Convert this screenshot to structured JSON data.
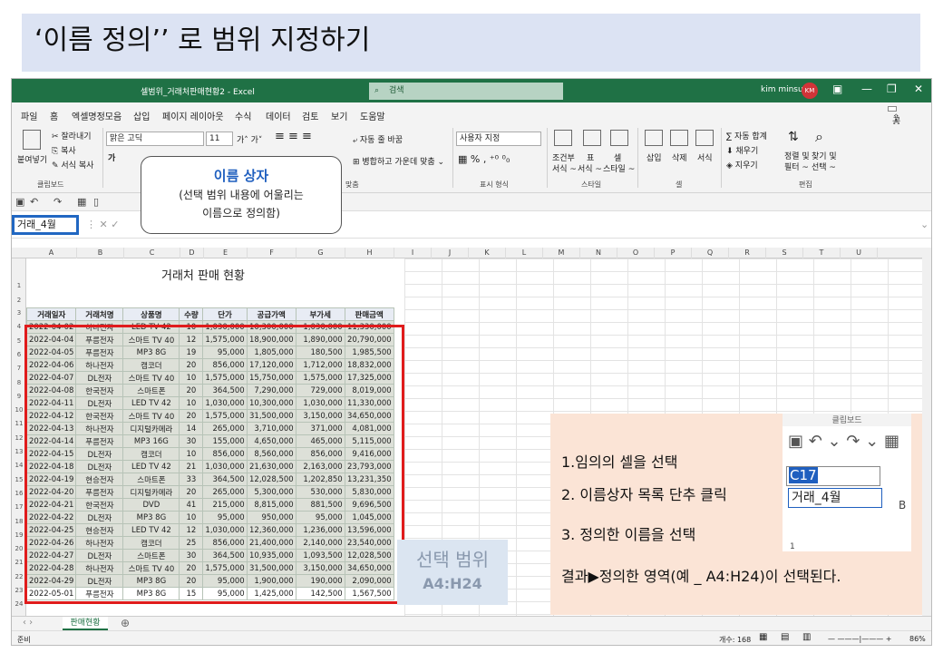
{
  "slide_title": "‘이름 정의’’ 로 범위 지정하기",
  "titlebar": {
    "doc_title": "셀범위_거래처판매현황2 - Excel",
    "search_placeholder": "검색",
    "user": "kim minsu",
    "avatar": "KM"
  },
  "tabs": [
    "파일",
    "홈",
    "엑셀명정모음",
    "삽입",
    "페이지 레이아웃",
    "수식",
    "데이터",
    "검토",
    "보기",
    "도움말"
  ],
  "share": "공유",
  "ribbon": {
    "cut": "잘라내기",
    "copy": "복사",
    "paste": "붙여넣기",
    "format_painter": "서식 복사",
    "font": "맑은 고딕",
    "font_size": "11",
    "wrap": "자동 줄 바꿈",
    "merge": "병합하고 가운데 맞춤",
    "number_format": "사용자 지정",
    "conditional": "조건부",
    "table": "표",
    "cell": "셀",
    "format_sub1": "서식 ~",
    "format_sub2": "서식 ~",
    "style_sub": "스타일 ~",
    "insert": "삽입",
    "delete": "삭제",
    "format": "서식",
    "autosum": "자동 합계",
    "fill": "채우기",
    "clear": "지우기",
    "sort": "정렬 및",
    "sort2": "필터 ~",
    "find": "찾기 및",
    "find2": "선택 ~",
    "group_clipboard": "클립보드",
    "group_align": "맞춤",
    "group_number": "표시 형식",
    "group_style": "스타일",
    "group_cells": "셀",
    "group_edit": "편집"
  },
  "namebox": "거래_4월",
  "callout": {
    "heading": "이름 상자",
    "line1": "(선택 범위 내용에 어울리는",
    "line2": "이름으로 정의함)"
  },
  "columns": [
    "A",
    "B",
    "C",
    "D",
    "E",
    "F",
    "G",
    "H",
    "I",
    "J",
    "K",
    "L",
    "M",
    "N",
    "O",
    "P",
    "Q",
    "R",
    "S",
    "T",
    "U"
  ],
  "sheet_title": "거래처 판매 현황",
  "table": {
    "headers": [
      "거래일자",
      "거래처명",
      "상품명",
      "수량",
      "단가",
      "공급가액",
      "부가세",
      "판매금액"
    ],
    "rows": [
      [
        "2022-04-02",
        "하나전자",
        "LED TV 42",
        "10",
        "1,030,000",
        "10,300,000",
        "1,030,000",
        "11,330,000"
      ],
      [
        "2022-04-04",
        "푸름전자",
        "스마트 TV 40",
        "12",
        "1,575,000",
        "18,900,000",
        "1,890,000",
        "20,790,000"
      ],
      [
        "2022-04-05",
        "푸름전자",
        "MP3 8G",
        "19",
        "95,000",
        "1,805,000",
        "180,500",
        "1,985,500"
      ],
      [
        "2022-04-06",
        "하나전자",
        "캠코더",
        "20",
        "856,000",
        "17,120,000",
        "1,712,000",
        "18,832,000"
      ],
      [
        "2022-04-07",
        "DL전자",
        "스마트 TV 40",
        "10",
        "1,575,000",
        "15,750,000",
        "1,575,000",
        "17,325,000"
      ],
      [
        "2022-04-08",
        "한국전자",
        "스마트폰",
        "20",
        "364,500",
        "7,290,000",
        "729,000",
        "8,019,000"
      ],
      [
        "2022-04-11",
        "DL전자",
        "LED TV 42",
        "10",
        "1,030,000",
        "10,300,000",
        "1,030,000",
        "11,330,000"
      ],
      [
        "2022-04-12",
        "한국전자",
        "스마트 TV 40",
        "20",
        "1,575,000",
        "31,500,000",
        "3,150,000",
        "34,650,000"
      ],
      [
        "2022-04-13",
        "하나전자",
        "디지털카메라",
        "14",
        "265,000",
        "3,710,000",
        "371,000",
        "4,081,000"
      ],
      [
        "2022-04-14",
        "푸름전자",
        "MP3 16G",
        "30",
        "155,000",
        "4,650,000",
        "465,000",
        "5,115,000"
      ],
      [
        "2022-04-15",
        "DL전자",
        "캠코더",
        "10",
        "856,000",
        "8,560,000",
        "856,000",
        "9,416,000"
      ],
      [
        "2022-04-18",
        "DL전자",
        "LED TV 42",
        "21",
        "1,030,000",
        "21,630,000",
        "2,163,000",
        "23,793,000"
      ],
      [
        "2022-04-19",
        "현승전자",
        "스마트폰",
        "33",
        "364,500",
        "12,028,500",
        "1,202,850",
        "13,231,350"
      ],
      [
        "2022-04-20",
        "푸름전자",
        "디지털카메라",
        "20",
        "265,000",
        "5,300,000",
        "530,000",
        "5,830,000"
      ],
      [
        "2022-04-21",
        "한국전자",
        "DVD",
        "41",
        "215,000",
        "8,815,000",
        "881,500",
        "9,696,500"
      ],
      [
        "2022-04-22",
        "DL전자",
        "MP3 8G",
        "10",
        "95,000",
        "950,000",
        "95,000",
        "1,045,000"
      ],
      [
        "2022-04-25",
        "현승전자",
        "LED TV 42",
        "12",
        "1,030,000",
        "12,360,000",
        "1,236,000",
        "13,596,000"
      ],
      [
        "2022-04-26",
        "하나전자",
        "캠코더",
        "25",
        "856,000",
        "21,400,000",
        "2,140,000",
        "23,540,000"
      ],
      [
        "2022-04-27",
        "DL전자",
        "스마트폰",
        "30",
        "364,500",
        "10,935,000",
        "1,093,500",
        "12,028,500"
      ],
      [
        "2022-04-28",
        "하나전자",
        "스마트 TV 40",
        "20",
        "1,575,000",
        "31,500,000",
        "3,150,000",
        "34,650,000"
      ],
      [
        "2022-04-29",
        "DL전자",
        "MP3 8G",
        "20",
        "95,000",
        "1,900,000",
        "190,000",
        "2,090,000"
      ],
      [
        "2022-05-01",
        "푸름전자",
        "MP3 8G",
        "15",
        "95,000",
        "1,425,000",
        "142,500",
        "1,567,500"
      ]
    ]
  },
  "sheet_tab": "판매현황",
  "status": {
    "ready": "준비",
    "count": "개수: 168",
    "zoom": "86%"
  },
  "selection_label": {
    "title": "선택 범위",
    "range": "A4:H24"
  },
  "steps": {
    "s1": "1.임의의 셀을 선택",
    "s2": "2. 이름상자 목록 단추 클릭",
    "s3": "3. 정의한 이름을 선택",
    "result": "결과▶정의한 영역(예 _ A4:H24)이 선택된다."
  },
  "inset": {
    "top": "클립보드",
    "cell_ref": "C17",
    "dropdown_item": "거래_4월",
    "col_b": "B",
    "row1": "1"
  }
}
